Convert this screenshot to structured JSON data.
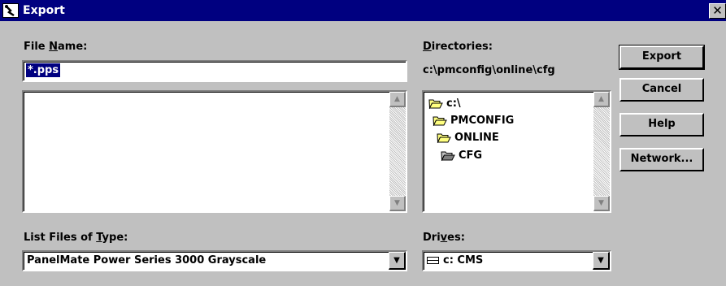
{
  "window": {
    "title": "Export",
    "close_glyph": "✕"
  },
  "file_name": {
    "label_pre": "File ",
    "label_key": "N",
    "label_post": "ame:",
    "value": "*.pps"
  },
  "files_list": {
    "items": []
  },
  "directories": {
    "label_key": "D",
    "label_post": "irectories:",
    "current_path": "c:\\pmconfig\\online\\cfg",
    "items": [
      {
        "label": "c:\\",
        "icon": "open-folder-icon"
      },
      {
        "label": "PMCONFIG",
        "icon": "open-folder-icon"
      },
      {
        "label": "ONLINE",
        "icon": "open-folder-icon"
      },
      {
        "label": "CFG",
        "icon": "open-folder-icon"
      }
    ]
  },
  "file_type": {
    "label_pre": "List Files of ",
    "label_key": "T",
    "label_post": "ype:",
    "value": "PanelMate Power Series 3000 Grayscale"
  },
  "drives": {
    "label_pre": "Dri",
    "label_key": "v",
    "label_post": "es:",
    "value": "c: CMS",
    "icon": "drive-icon"
  },
  "buttons": {
    "export": "Export",
    "cancel": "Cancel",
    "help": "Help",
    "network": "Network..."
  },
  "colors": {
    "titlebar": "#000080",
    "dialog": "#c0c0c0",
    "selection": "#000080",
    "folder": "#ffff80"
  }
}
